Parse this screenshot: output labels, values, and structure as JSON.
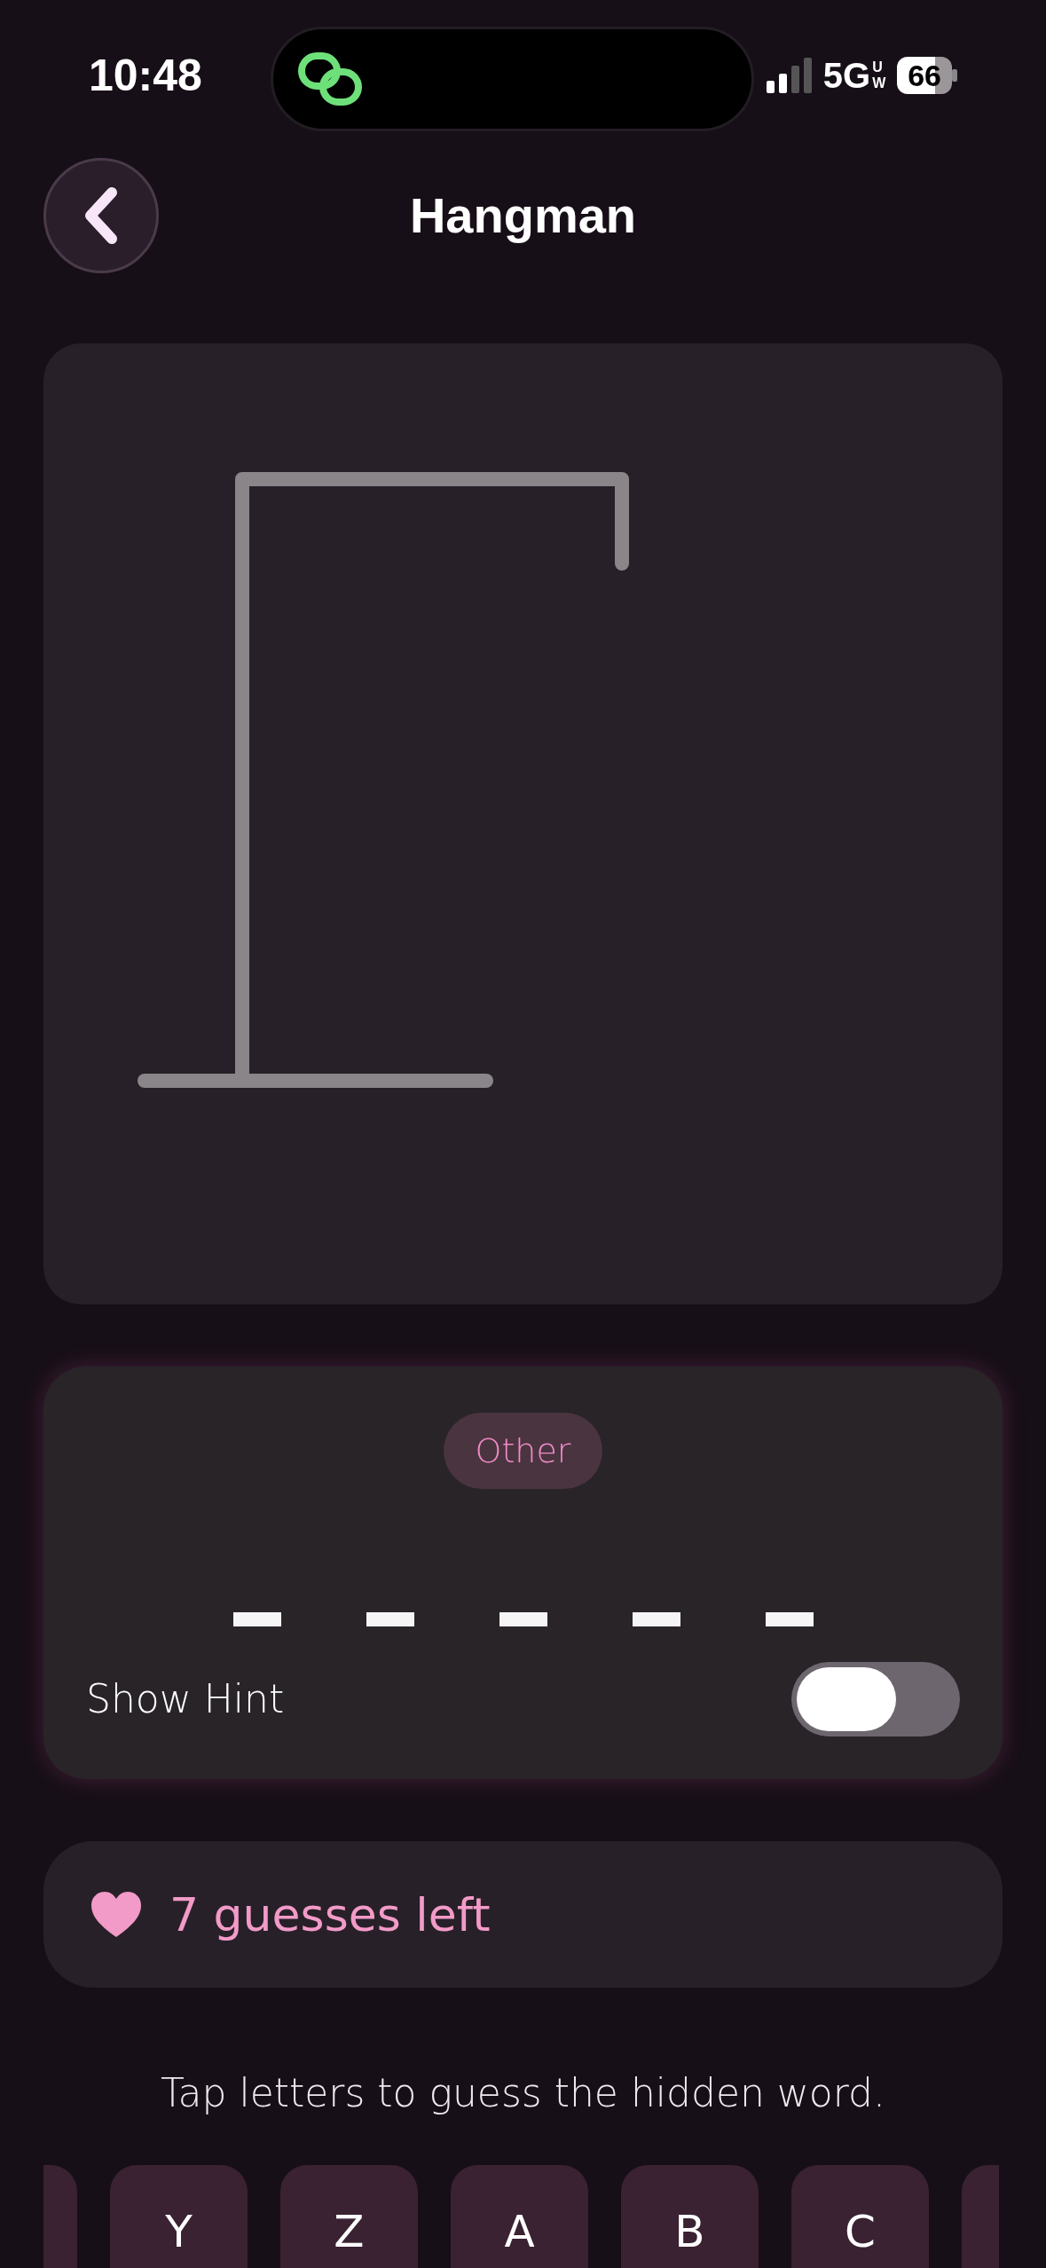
{
  "status_bar": {
    "time": "10:48",
    "network": "5G",
    "network_badge": "UW",
    "battery": "66"
  },
  "header": {
    "title": "Hangman"
  },
  "word": {
    "category": "Other",
    "slots": [
      {
        "revealed": false
      },
      {
        "revealed": false
      },
      {
        "revealed": false
      },
      {
        "revealed": false
      },
      {
        "revealed": false
      }
    ]
  },
  "hint": {
    "label": "Show Hint",
    "on": false
  },
  "guesses": {
    "text": "7 guesses left"
  },
  "instruction": "Tap letters to guess the hidden word.",
  "keys": [
    {
      "letter": "Y"
    },
    {
      "letter": "Z"
    },
    {
      "letter": "A"
    },
    {
      "letter": "B"
    },
    {
      "letter": "C"
    }
  ]
}
